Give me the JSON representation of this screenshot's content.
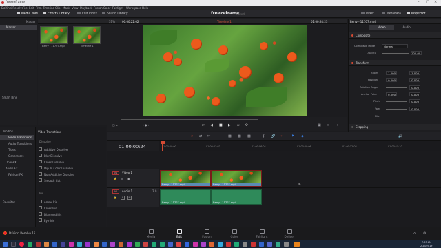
{
  "window": {
    "title": "freezeframe"
  },
  "menu": [
    "DaVinci Resolve",
    "File",
    "Edit",
    "Trim",
    "Timeline",
    "Clip",
    "Mark",
    "View",
    "Playback",
    "Fusion",
    "Color",
    "Fairlight",
    "Workspace",
    "Help"
  ],
  "toolbar": {
    "media_pool": "Media Pool",
    "effects_library": "Effects Library",
    "edit_index": "Edit Index",
    "sound_library": "Sound Library",
    "mixer": "Mixer",
    "metadata": "Metadata",
    "inspector": "Inspector"
  },
  "project": {
    "name": "freezeframe",
    "status": "Edited"
  },
  "bins": {
    "master": "Master",
    "smart_bins": "Smart Bins",
    "path": "Master"
  },
  "media_pool": {
    "clips": [
      {
        "name": "Berry - 11707.mp4"
      },
      {
        "name": "Timeline 1"
      }
    ]
  },
  "viewer": {
    "zoom": "37%",
    "timecode_in": "00:00:22:02",
    "timeline_name": "Timeline 1",
    "timecode_out": "01:00:24:23"
  },
  "inspector": {
    "clip_title": "Berry - 11707.mp4",
    "tabs": [
      "Video",
      "Audio"
    ],
    "sections": {
      "composite": "Composite",
      "transform": "Transform",
      "cropping": "Cropping"
    },
    "composite_mode_label": "Composite Mode",
    "composite_mode": "Normal",
    "opacity_label": "Opacity",
    "opacity": "100.00",
    "transform": {
      "zoom_label": "Zoom",
      "zoom_x": "1.000",
      "zoom_y": "1.000",
      "position_label": "Position",
      "pos_x": "0.000",
      "pos_y": "0.000",
      "rotation_label": "Rotation Angle",
      "rotation": "0.000",
      "anchor_label": "Anchor Point",
      "anchor_x": "0.000",
      "anchor_y": "0.000",
      "pitch_label": "Pitch",
      "pitch": "0.000",
      "yaw_label": "Yaw",
      "yaw": "0.000",
      "flip_label": "Flip"
    }
  },
  "effects": {
    "toolbox": "Toolbox",
    "categories": [
      "Video Transitions",
      "Audio Transitions",
      "Titles",
      "Generators",
      "OpenFX",
      "Audio FX",
      "FairlightFX"
    ],
    "section_title": "Video Transitions",
    "group_dissolve": "Dissolve",
    "dissolve_items": [
      "Additive Dissolve",
      "Blur Dissolve",
      "Cross Dissolve",
      "Dip To Color Dissolve",
      "Non-Additive Dissolve",
      "Smooth Cut"
    ],
    "group_iris": "Iris",
    "iris_items": [
      "Arrow Iris",
      "Cross Iris",
      "Diamond Iris",
      "Eye Iris"
    ],
    "favorites": "Favorites"
  },
  "timeline": {
    "timecode": "01:00:00:24",
    "ruler": [
      "01:00:00:00",
      "01:00:03:02",
      "01:00:06:04",
      "01:00:09:06",
      "01:00:12:08",
      "01:00:15:10"
    ],
    "video_track": {
      "id": "V1",
      "name": "Video 1",
      "clips": [
        "Berry - 11707.mp4",
        "Berry - 11707.mp4"
      ]
    },
    "audio_track": {
      "id": "A1",
      "name": "Audio 1",
      "level": "2.0",
      "clips": [
        "Berry - 11707.mp4",
        "Berry - 11707.mp4"
      ]
    }
  },
  "app": {
    "name": "DaVinci Resolve 15"
  },
  "pages": [
    "Media",
    "Edit",
    "Fusion",
    "Color",
    "Fairlight",
    "Deliver"
  ],
  "active_page": "Edit",
  "clock": {
    "time": "7:03 AM",
    "date": "2/23/2019"
  }
}
